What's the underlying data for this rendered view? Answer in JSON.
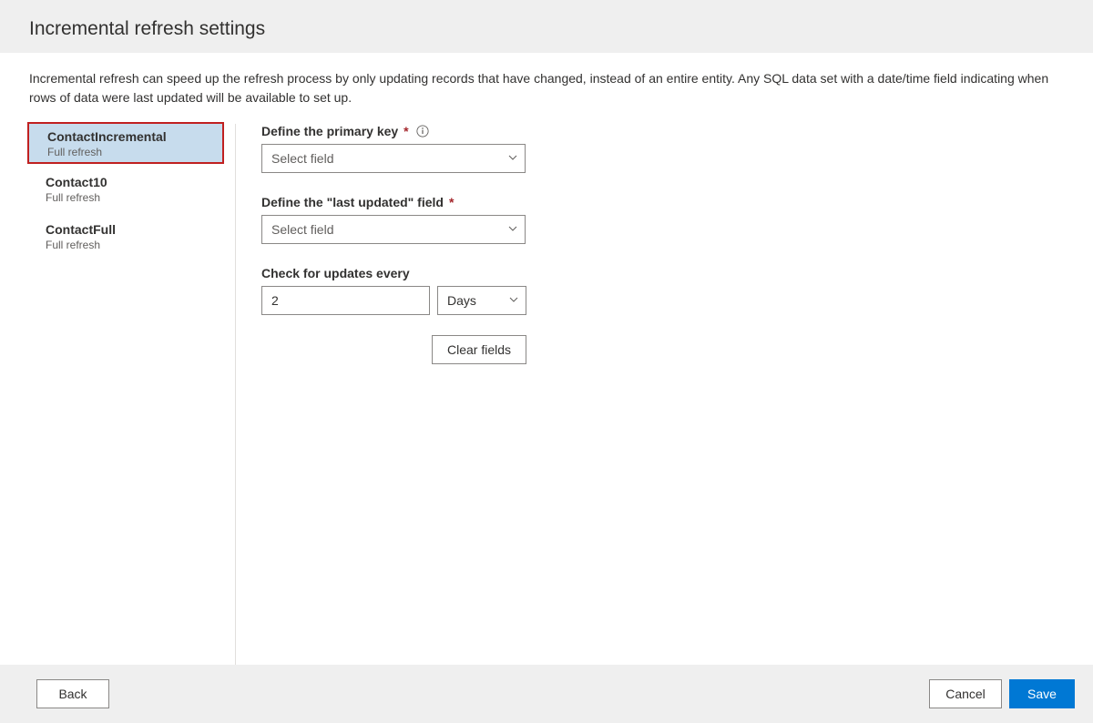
{
  "header": {
    "title": "Incremental refresh settings"
  },
  "description": "Incremental refresh can speed up the refresh process by only updating records that have changed, instead of an entire entity. Any SQL data set with a date/time field indicating when rows of data were last updated will be available to set up.",
  "sidebar": {
    "items": [
      {
        "title": "ContactIncremental",
        "sub": "Full refresh",
        "selected": true
      },
      {
        "title": "Contact10",
        "sub": "Full refresh",
        "selected": false
      },
      {
        "title": "ContactFull",
        "sub": "Full refresh",
        "selected": false
      }
    ]
  },
  "form": {
    "primary_key": {
      "label": "Define the primary key",
      "placeholder": "Select field"
    },
    "last_updated": {
      "label": "Define the \"last updated\" field",
      "placeholder": "Select field"
    },
    "check_updates": {
      "label": "Check for updates every",
      "value": "2",
      "unit": "Days"
    },
    "clear_fields": "Clear fields"
  },
  "footer": {
    "back": "Back",
    "cancel": "Cancel",
    "save": "Save"
  }
}
